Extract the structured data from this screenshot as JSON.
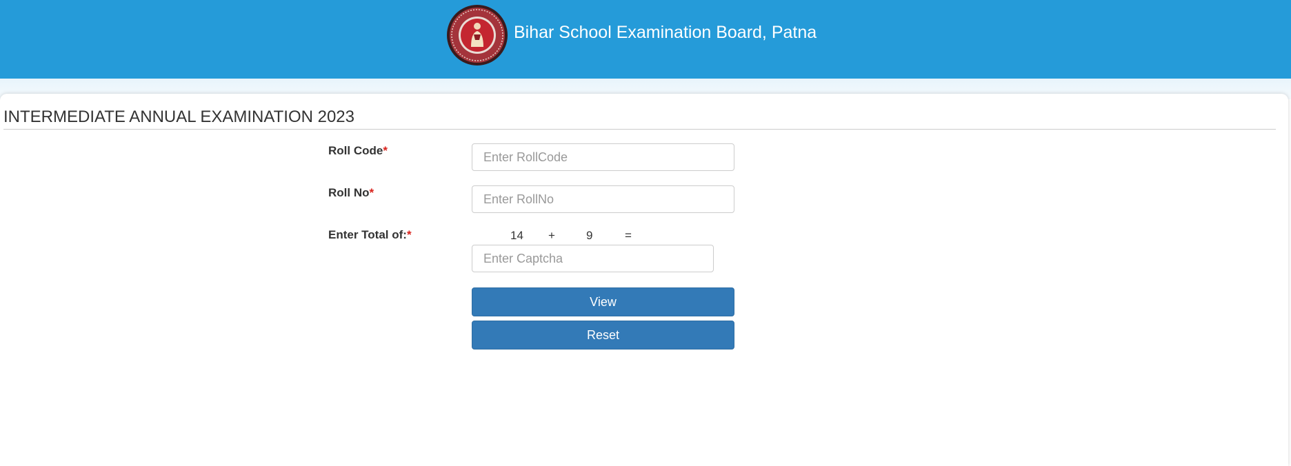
{
  "header": {
    "title": "Bihar School Examination Board, Patna",
    "bg_color": "#259bd9",
    "logo_icon": "bseb-emblem-logo"
  },
  "exam": {
    "title": "INTERMEDIATE ANNUAL EXAMINATION 2023"
  },
  "form": {
    "roll_code": {
      "label": "Roll Code",
      "required_mark": "*",
      "placeholder": "Enter RollCode",
      "value": ""
    },
    "roll_no": {
      "label": "Roll No",
      "required_mark": "*",
      "placeholder": "Enter RollNo",
      "value": ""
    },
    "captcha": {
      "label": "Enter Total of:",
      "required_mark": "*",
      "operand1": "14",
      "operator": "+",
      "operand2": "9",
      "equals": "=",
      "placeholder": "Enter Captcha",
      "value": ""
    },
    "view_button": "View",
    "reset_button": "Reset",
    "button_color": "#337ab7",
    "required_color": "#d9221c"
  }
}
